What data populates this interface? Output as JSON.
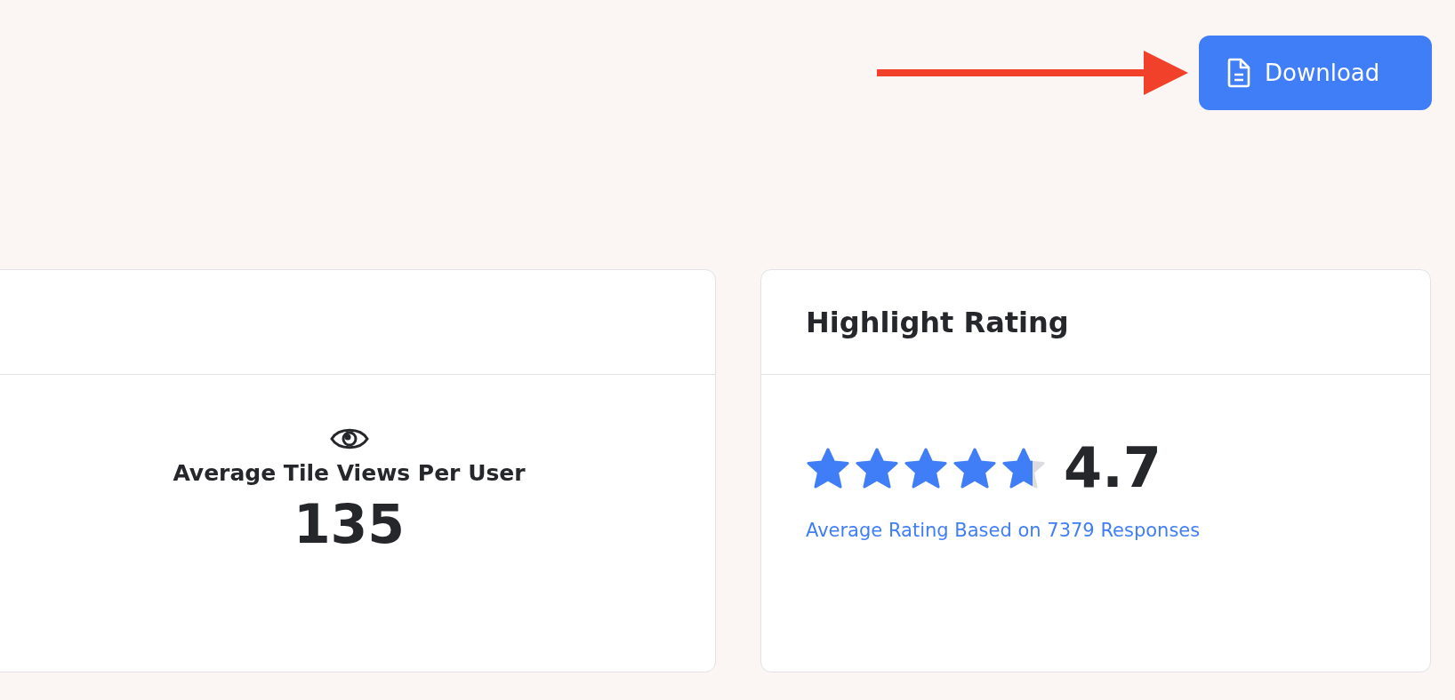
{
  "toolbar": {
    "download_button": "Download"
  },
  "views_card": {
    "label": "Average Tile Views Per User",
    "value": "135"
  },
  "rating_card": {
    "title": "Highlight Rating",
    "stars": 4.7,
    "rating": "4.7",
    "caption": "Average Rating Based on 7379 Responses"
  }
}
